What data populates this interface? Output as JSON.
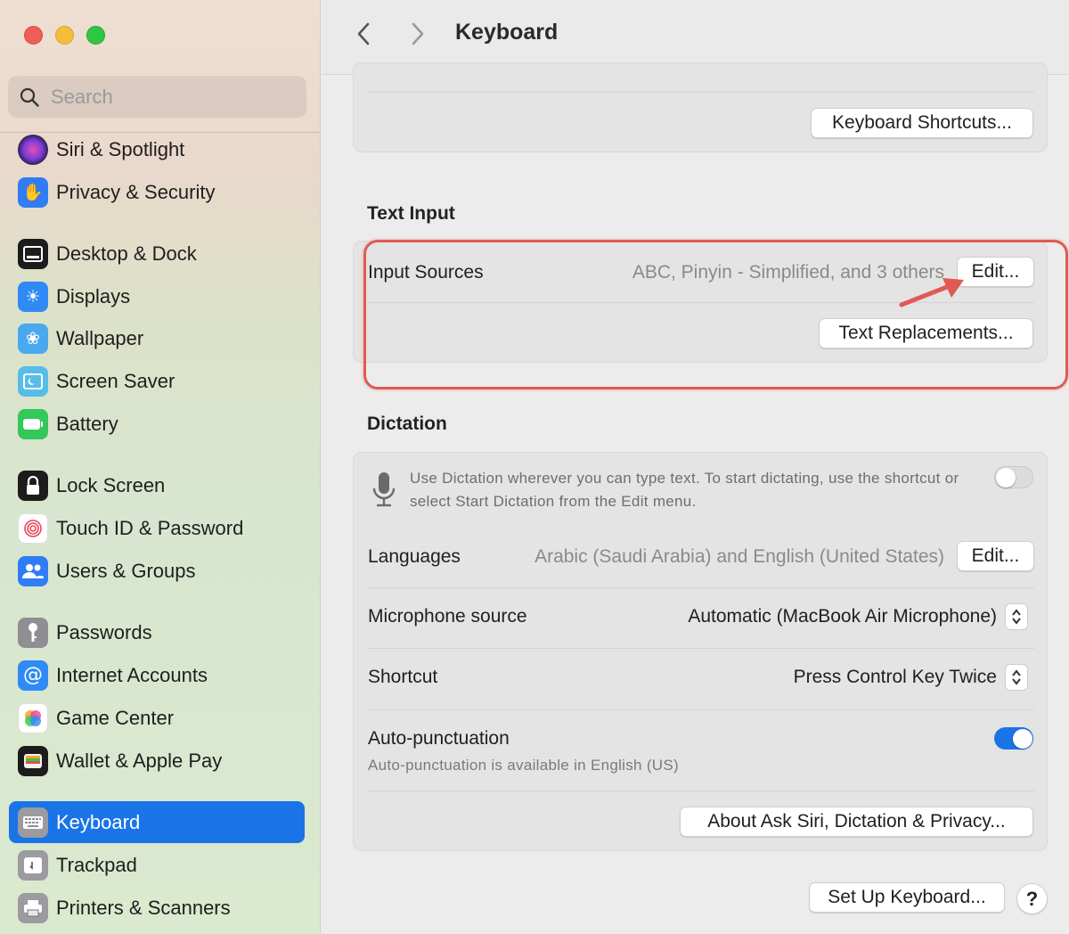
{
  "window": {
    "title": "Keyboard"
  },
  "sidebar": {
    "search_placeholder": "Search",
    "items": [
      {
        "label": "Siri & Spotlight",
        "icon": "siri-icon",
        "color": "#3a2a6e"
      },
      {
        "label": "Privacy & Security",
        "icon": "hand-icon",
        "color": "#2f7cf6"
      },
      {
        "label": "Desktop & Dock",
        "icon": "dock-icon",
        "color": "#1c1c1c"
      },
      {
        "label": "Displays",
        "icon": "sun-icon",
        "color": "#2f8af5"
      },
      {
        "label": "Wallpaper",
        "icon": "flower-icon",
        "color": "#46a8f0"
      },
      {
        "label": "Screen Saver",
        "icon": "screen-saver-icon",
        "color": "#4ab3e6"
      },
      {
        "label": "Battery",
        "icon": "battery-icon",
        "color": "#34c759"
      },
      {
        "label": "Lock Screen",
        "icon": "lock-icon",
        "color": "#1c1c1c"
      },
      {
        "label": "Touch ID & Password",
        "icon": "fingerprint-icon",
        "color": "#ffffff"
      },
      {
        "label": "Users & Groups",
        "icon": "users-icon",
        "color": "#2f7cf6"
      },
      {
        "label": "Passwords",
        "icon": "key-icon",
        "color": "#8e8e93"
      },
      {
        "label": "Internet Accounts",
        "icon": "at-icon",
        "color": "#2f8af5"
      },
      {
        "label": "Game Center",
        "icon": "game-center-icon",
        "color": "#ffffff"
      },
      {
        "label": "Wallet & Apple Pay",
        "icon": "wallet-icon",
        "color": "#1c1c1c"
      },
      {
        "label": "Keyboard",
        "icon": "keyboard-icon",
        "color": "#8e8e93",
        "active": true
      },
      {
        "label": "Trackpad",
        "icon": "trackpad-icon",
        "color": "#8e8e93"
      },
      {
        "label": "Printers & Scanners",
        "icon": "printer-icon",
        "color": "#8e8e93"
      }
    ]
  },
  "keyboard_shortcuts_button": "Keyboard Shortcuts...",
  "text_input": {
    "title": "Text Input",
    "input_sources_label": "Input Sources",
    "input_sources_value": "ABC, Pinyin - Simplified, and 3 others",
    "edit_button": "Edit...",
    "text_replacements_button": "Text Replacements..."
  },
  "dictation": {
    "title": "Dictation",
    "description": "Use Dictation wherever you can type text. To start dictating, use the shortcut or select Start Dictation from the Edit menu.",
    "enabled": false,
    "languages_label": "Languages",
    "languages_value": "Arabic (Saudi Arabia) and English (United States)",
    "languages_edit_button": "Edit...",
    "microphone_label": "Microphone source",
    "microphone_value": "Automatic (MacBook Air Microphone)",
    "shortcut_label": "Shortcut",
    "shortcut_value": "Press Control Key Twice",
    "auto_punct_label": "Auto-punctuation",
    "auto_punct_sub": "Auto-punctuation is available in English (US)",
    "auto_punct_enabled": true,
    "about_button": "About Ask Siri, Dictation & Privacy..."
  },
  "footer": {
    "setup_button": "Set Up Keyboard...",
    "help_button": "?"
  },
  "colors": {
    "accent": "#1a74e8",
    "annotation": "#e05a54"
  }
}
